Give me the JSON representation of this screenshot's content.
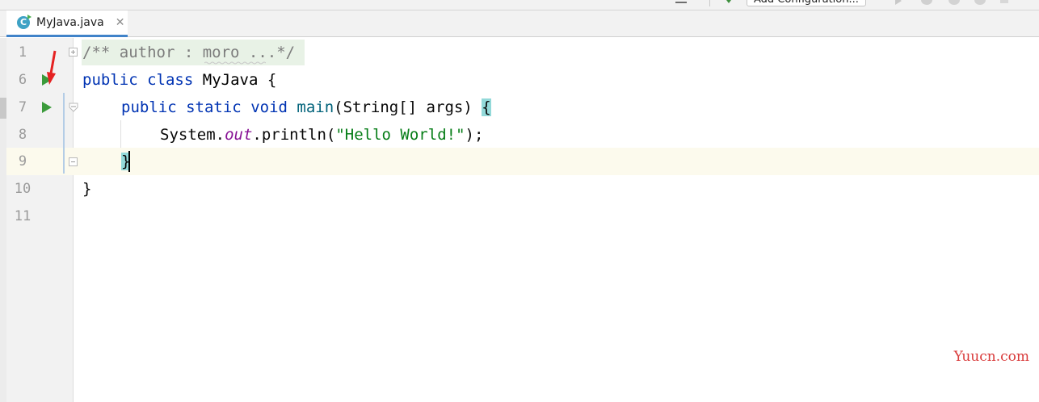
{
  "toolbar": {
    "config_label": "Add Configuration..."
  },
  "tabs": [
    {
      "label": "MyJava.java",
      "icon": "class-icon",
      "active": true
    }
  ],
  "gutter": {
    "line_numbers": [
      "1",
      "6",
      "7",
      "8",
      "9",
      "10",
      "11"
    ]
  },
  "code": {
    "line1_comment": "/** author : moro ...*/",
    "line6_public": "public",
    "line6_class": "class",
    "line6_name": "MyJava",
    "line6_brace": "{",
    "line7_public": "public",
    "line7_static": "static",
    "line7_void": "void",
    "line7_method": "main",
    "line7_params": "(String[] args) ",
    "line7_brace": "{",
    "line8_system": "System.",
    "line8_field": "out",
    "line8_call": ".println(",
    "line8_string": "\"Hello World!\"",
    "line8_end": ");",
    "line9_brace": "}",
    "line10_brace": "}"
  },
  "watermark": "Yuucn.com",
  "colors": {
    "keyword": "#0033b3",
    "string": "#067d17",
    "field": "#871094",
    "comment": "#7c7c7c",
    "run": "#3b9b3b",
    "tab_underline": "#4083c9"
  }
}
